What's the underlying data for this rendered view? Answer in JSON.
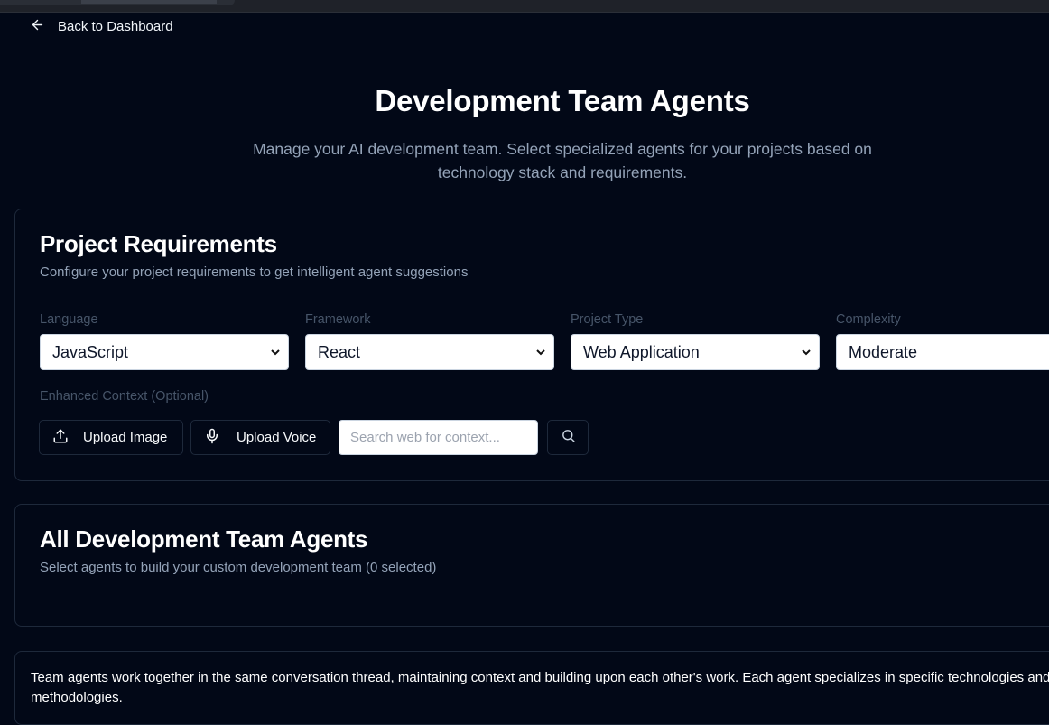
{
  "nav": {
    "back_label": "Back to Dashboard"
  },
  "header": {
    "title": "Development Team Agents",
    "subtitle": "Manage your AI development team. Select specialized agents for your projects based on technology stack and requirements."
  },
  "requirements": {
    "title": "Project Requirements",
    "description": "Configure your project requirements to get intelligent agent suggestions",
    "fields": [
      {
        "label": "Language",
        "value": "JavaScript"
      },
      {
        "label": "Framework",
        "value": "React"
      },
      {
        "label": "Project Type",
        "value": "Web Application"
      },
      {
        "label": "Complexity",
        "value": "Moderate"
      }
    ],
    "context_label": "Enhanced Context (Optional)",
    "upload_image_label": "Upload Image",
    "upload_voice_label": "Upload Voice",
    "search_placeholder": "Search web for context..."
  },
  "agents": {
    "title": "All Development Team Agents",
    "description": "Select agents to build your custom development team (0 selected)"
  },
  "info": {
    "text": "Team agents work together in the same conversation thread, maintaining context and building upon each other's work. Each agent specializes in specific technologies and methodologies."
  },
  "icons": {
    "back": "arrow-left-icon",
    "upload": "upload-icon",
    "voice": "microphone-icon",
    "search": "search-icon",
    "select": "chevron-down-icon"
  },
  "colors": {
    "background": "#020817",
    "border": "#1e293b",
    "muted_text": "#94a3b8",
    "label_text": "#475569"
  }
}
